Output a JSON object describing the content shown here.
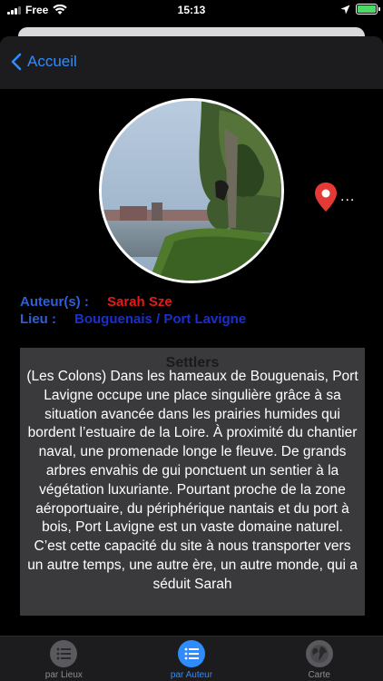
{
  "status_bar": {
    "carrier": "Free",
    "time": "15:13"
  },
  "nav": {
    "back_label": "Accueil"
  },
  "artwork": {
    "author_label": "Auteur(s) :",
    "author": "Sarah Sze",
    "place_label": "Lieu :",
    "place": "Bouguenais / Port Lavigne",
    "more": "...",
    "title": "Settlers",
    "description": "(Les Colons) Dans les hameaux de Bouguenais, Port Lavigne occupe une place singulière grâce à sa situation avancée dans les prairies humides qui bordent l’estuaire de la Loire. À proximité du chantier naval, une promenade longe le fleuve. De grands arbres envahis de gui ponctuent un sentier à la végétation luxuriante. Pourtant proche de la zone aéroportuaire, du périphérique nantais et du port à bois, Port Lavigne est un vaste domaine naturel. C’est cette capacité du site à nous transporter vers un autre temps, une autre ère, un autre monde, qui a séduit Sarah"
  },
  "tabs": [
    {
      "label": "par Lieux",
      "icon": "list-icon",
      "active": false
    },
    {
      "label": "par Auteur",
      "icon": "list-icon",
      "active": true
    },
    {
      "label": "Carte",
      "icon": "globe-icon",
      "active": false
    }
  ],
  "colors": {
    "accent": "#2f8cff",
    "author": "#e01b1b",
    "place": "#1a2fcf",
    "label": "#2f5fd6",
    "pin": "#e53935"
  }
}
